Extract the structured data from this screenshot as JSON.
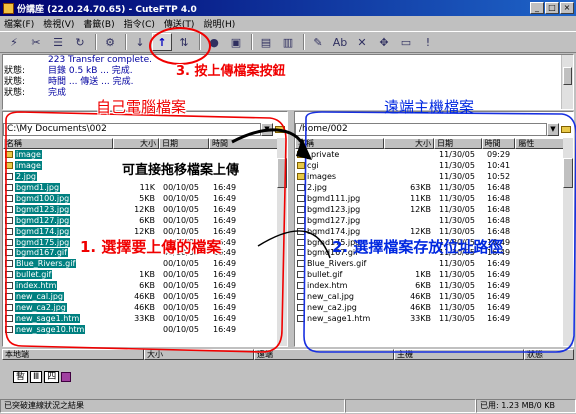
{
  "window": {
    "title": "份講座 (22.0.24.70.65) - CuteFTP 4.0"
  },
  "menu": [
    "檔案(F)",
    "檢視(V)",
    "書籤(B)",
    "指令(C)",
    "傳送(T)",
    "說明(H)"
  ],
  "log": [
    {
      "label": "",
      "message": "223 Transfer complete."
    },
    {
      "label": "狀態:",
      "message": "目錄 0.5 kB ... 完成."
    },
    {
      "label": "狀態:",
      "message": "時間 ... 傳送 ... 完成."
    },
    {
      "label": "狀態:",
      "message": "完成"
    }
  ],
  "local": {
    "path": "C:\\My Documents\\002",
    "columns": [
      "名稱",
      "大小",
      "日期",
      "時間"
    ],
    "files": [
      {
        "name": "image",
        "size": "",
        "date": "",
        "time": "",
        "type": "folder"
      },
      {
        "name": "image",
        "size": "",
        "date": "",
        "time": "",
        "type": "folder"
      },
      {
        "name": "2.jpg",
        "size": "",
        "date": "",
        "time": "",
        "type": "file"
      },
      {
        "name": "bgmd1.jpg",
        "size": "11K",
        "date": "00/10/05",
        "time": "16:49",
        "type": "file"
      },
      {
        "name": "bgmd100.jpg",
        "size": "5KB",
        "date": "00/10/05",
        "time": "16:49",
        "type": "file"
      },
      {
        "name": "bgmd123.jpg",
        "size": "12KB",
        "date": "00/10/05",
        "time": "16:49",
        "type": "file"
      },
      {
        "name": "bgmd127.jpg",
        "size": "6KB",
        "date": "00/10/05",
        "time": "16:49",
        "type": "file"
      },
      {
        "name": "bgmd174.jpg",
        "size": "12KB",
        "date": "00/10/05",
        "time": "16:49",
        "type": "file"
      },
      {
        "name": "bgmd175.jpg",
        "size": "",
        "date": "00/10/05",
        "time": "16:49",
        "type": "file"
      },
      {
        "name": "bgmd167.gif",
        "size": "",
        "date": "00/10/05",
        "time": "16:49",
        "type": "file"
      },
      {
        "name": "Blue_Rivers.gif",
        "size": "",
        "date": "00/10/05",
        "time": "16:49",
        "type": "file"
      },
      {
        "name": "bullet.gif",
        "size": "1KB",
        "date": "00/10/05",
        "time": "16:49",
        "type": "file"
      },
      {
        "name": "index.htm",
        "size": "6KB",
        "date": "00/10/05",
        "time": "16:49",
        "type": "file"
      },
      {
        "name": "new_cal.jpg",
        "size": "46KB",
        "date": "00/10/05",
        "time": "16:49",
        "type": "file"
      },
      {
        "name": "new_ca2.jpg",
        "size": "46KB",
        "date": "00/10/05",
        "time": "16:49",
        "type": "file"
      },
      {
        "name": "new_sage1.htm",
        "size": "33KB",
        "date": "00/10/05",
        "time": "16:49",
        "type": "file"
      },
      {
        "name": "new_sage10.htm",
        "size": "",
        "date": "00/10/05",
        "time": "16:49",
        "type": "file"
      }
    ]
  },
  "remote": {
    "path": "/home/002",
    "columns": [
      "名稱",
      "大小",
      "日期",
      "時間",
      "屬性"
    ],
    "files": [
      {
        "name": "_private",
        "size": "",
        "date": "11/30/05",
        "time": "09:29",
        "type": "folder"
      },
      {
        "name": "cgi",
        "size": "",
        "date": "11/30/05",
        "time": "10:41",
        "type": "folder"
      },
      {
        "name": "images",
        "size": "",
        "date": "11/30/05",
        "time": "10:52",
        "type": "folder"
      },
      {
        "name": "2.jpg",
        "size": "63KB",
        "date": "11/30/05",
        "time": "16:48",
        "type": "file"
      },
      {
        "name": "bgmd111.jpg",
        "size": "11KB",
        "date": "11/30/05",
        "time": "16:48",
        "type": "file"
      },
      {
        "name": "bgmd123.jpg",
        "size": "12KB",
        "date": "11/30/05",
        "time": "16:48",
        "type": "file"
      },
      {
        "name": "bgmd127.jpg",
        "size": "",
        "date": "11/30/05",
        "time": "16:48",
        "type": "file"
      },
      {
        "name": "bgmd174.jpg",
        "size": "12KB",
        "date": "11/30/05",
        "time": "16:48",
        "type": "file"
      },
      {
        "name": "bgmd175.jpg",
        "size": "",
        "date": "11/30/05",
        "time": "16:49",
        "type": "file"
      },
      {
        "name": "bgmd167.gif",
        "size": "",
        "date": "11/30/05",
        "time": "16:49",
        "type": "file"
      },
      {
        "name": "Blue_Rivers.gif",
        "size": "",
        "date": "11/30/05",
        "time": "16:49",
        "type": "file"
      },
      {
        "name": "bullet.gif",
        "size": "1KB",
        "date": "11/30/05",
        "time": "16:49",
        "type": "file"
      },
      {
        "name": "index.htm",
        "size": "6KB",
        "date": "11/30/05",
        "time": "16:49",
        "type": "file"
      },
      {
        "name": "new_cal.jpg",
        "size": "46KB",
        "date": "11/30/05",
        "time": "16:49",
        "type": "file"
      },
      {
        "name": "new_ca2.jpg",
        "size": "46KB",
        "date": "11/30/05",
        "time": "16:49",
        "type": "file"
      },
      {
        "name": "new_sage1.htm",
        "size": "33KB",
        "date": "11/30/05",
        "time": "16:49",
        "type": "file"
      }
    ]
  },
  "queue": {
    "columns": [
      "本地端",
      "大小",
      "遠端",
      "主機",
      "狀態"
    ],
    "tray_labels": [
      "暫",
      "Ⅲ",
      "四"
    ]
  },
  "status": {
    "left": "已突破連線狀況之結果",
    "right": "已用: 1.23 MB/0 KB"
  },
  "annotations": {
    "step3": "3. 按上傳檔案按鈕",
    "local_title": "自己電腦檔案",
    "remote_title": "遠端主機檔案",
    "drag_hint": "可直接拖移檔案上傳",
    "step1": "1. 選擇要上傳的檔案",
    "step2": "2. 選擇檔案存放位址路徑"
  },
  "colors": {
    "annotation_red": "#f00000",
    "annotation_blue": "#0028e0",
    "selection": "#008080"
  }
}
